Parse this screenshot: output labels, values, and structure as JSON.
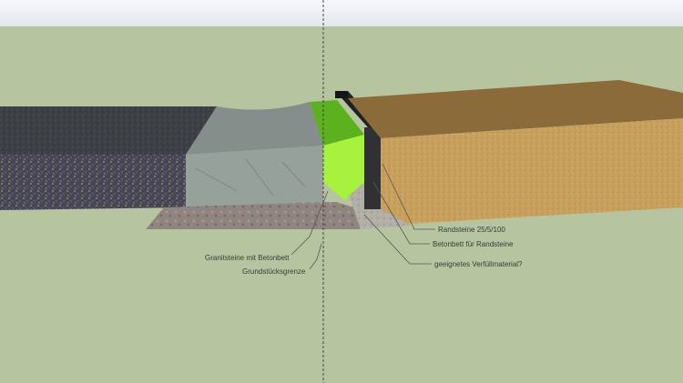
{
  "model": {
    "callouts": {
      "randsteine": "Randsteine 25/5/100",
      "betonbett": "Betonbett für Randsteine",
      "verfuellmaterial": "geeignetes Verfüllmaterial?",
      "granitsteine": "Granitsteine mit Betonbett",
      "grundstuecksgrenze": "Grundstücksgrenze"
    },
    "colors": {
      "background": "#b6c5a0",
      "sky": "#eef1f5",
      "asphalt": "#3b3f44",
      "gravel": "#4b4a5a",
      "granite": "#8d9792",
      "concrete_bed": "#a6e23a",
      "curb": "#2f3133",
      "soil_top": "#8b6b3a",
      "soil_side": "#c9a15e",
      "fill": "#b3afa8"
    }
  }
}
